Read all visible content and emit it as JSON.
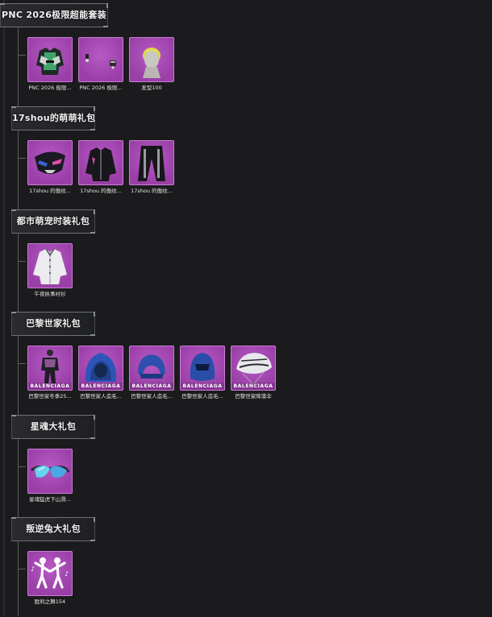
{
  "sections": [
    {
      "title": "PNC 2026极限超能套装",
      "items": [
        {
          "label": "PNC 2026 极限...",
          "icon": "jacket-icon"
        },
        {
          "label": "PNC 2026 极限...",
          "icon": "earrings-icon"
        },
        {
          "label": "发型100",
          "icon": "hairstyle-icon"
        }
      ]
    },
    {
      "title": "17shou的萌萌礼包",
      "items": [
        {
          "label": "17shou 的傲纹...",
          "icon": "mask-icon"
        },
        {
          "label": "17shou 的傲纹...",
          "icon": "jacket-icon"
        },
        {
          "label": "17shou 的傲纹...",
          "icon": "pants-icon"
        }
      ]
    },
    {
      "title": "都市萌宠时装礼包",
      "items": [
        {
          "label": "午夜执事衬衫",
          "icon": "shirt-icon"
        }
      ]
    },
    {
      "title": "巴黎世家礼包",
      "items": [
        {
          "label": "巴黎世家冬季25...",
          "brand": "BALENCIAGA",
          "icon": "outfit-icon"
        },
        {
          "label": "巴黎世家人造毛...",
          "brand": "BALENCIAGA",
          "icon": "fur-hood-icon"
        },
        {
          "label": "巴黎世家人造毛...",
          "brand": "BALENCIAGA",
          "icon": "fur-helmet-icon"
        },
        {
          "label": "巴黎世家人造毛...",
          "brand": "BALENCIAGA",
          "icon": "fur-mask-icon"
        },
        {
          "label": "巴黎世家降落伞",
          "brand": "BALENCIAGA",
          "icon": "parachute-icon"
        }
      ]
    },
    {
      "title": "星魂大礼包",
      "items": [
        {
          "label": "星魂猛虎下山滑...",
          "icon": "goggles-icon"
        }
      ]
    },
    {
      "title": "叛逆兔大礼包",
      "items": [
        {
          "label": "胜利之舞154",
          "icon": "dance-icon"
        }
      ]
    }
  ],
  "colors": {
    "background": "#1b1b1d",
    "tile": "#a64bb5",
    "spine": "#5b5d63"
  }
}
